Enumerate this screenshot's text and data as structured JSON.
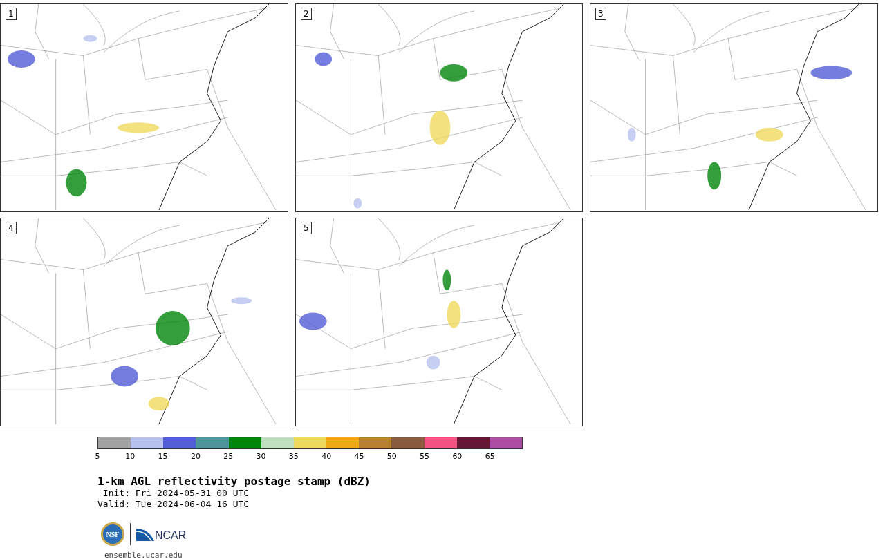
{
  "panels": [
    {
      "label": "1"
    },
    {
      "label": "2"
    },
    {
      "label": "3"
    },
    {
      "label": "4"
    },
    {
      "label": "5"
    }
  ],
  "colorbar": {
    "segments": [
      {
        "color": "#a3a3a3"
      },
      {
        "color": "#b8c2ee"
      },
      {
        "color": "#525ed6"
      },
      {
        "color": "#4f949b"
      },
      {
        "color": "#00860a"
      },
      {
        "color": "#c0dfbe"
      },
      {
        "color": "#efd95c"
      },
      {
        "color": "#efab16"
      },
      {
        "color": "#b88132"
      },
      {
        "color": "#8a5a3e"
      },
      {
        "color": "#f45283"
      },
      {
        "color": "#631835"
      },
      {
        "color": "#ab4ea3"
      }
    ],
    "ticks": [
      "5",
      "10",
      "15",
      "20",
      "25",
      "30",
      "35",
      "40",
      "45",
      "50",
      "55",
      "60",
      "65"
    ]
  },
  "title": "1-km AGL reflectivity postage stamp (dBZ)",
  "init": " Init: Fri 2024-05-31 00 UTC",
  "valid": "Valid: Tue 2024-06-04 16 UTC",
  "logos": {
    "nsf": "NSF",
    "ncar": "NCAR"
  },
  "url": "ensemble.ucar.edu"
}
